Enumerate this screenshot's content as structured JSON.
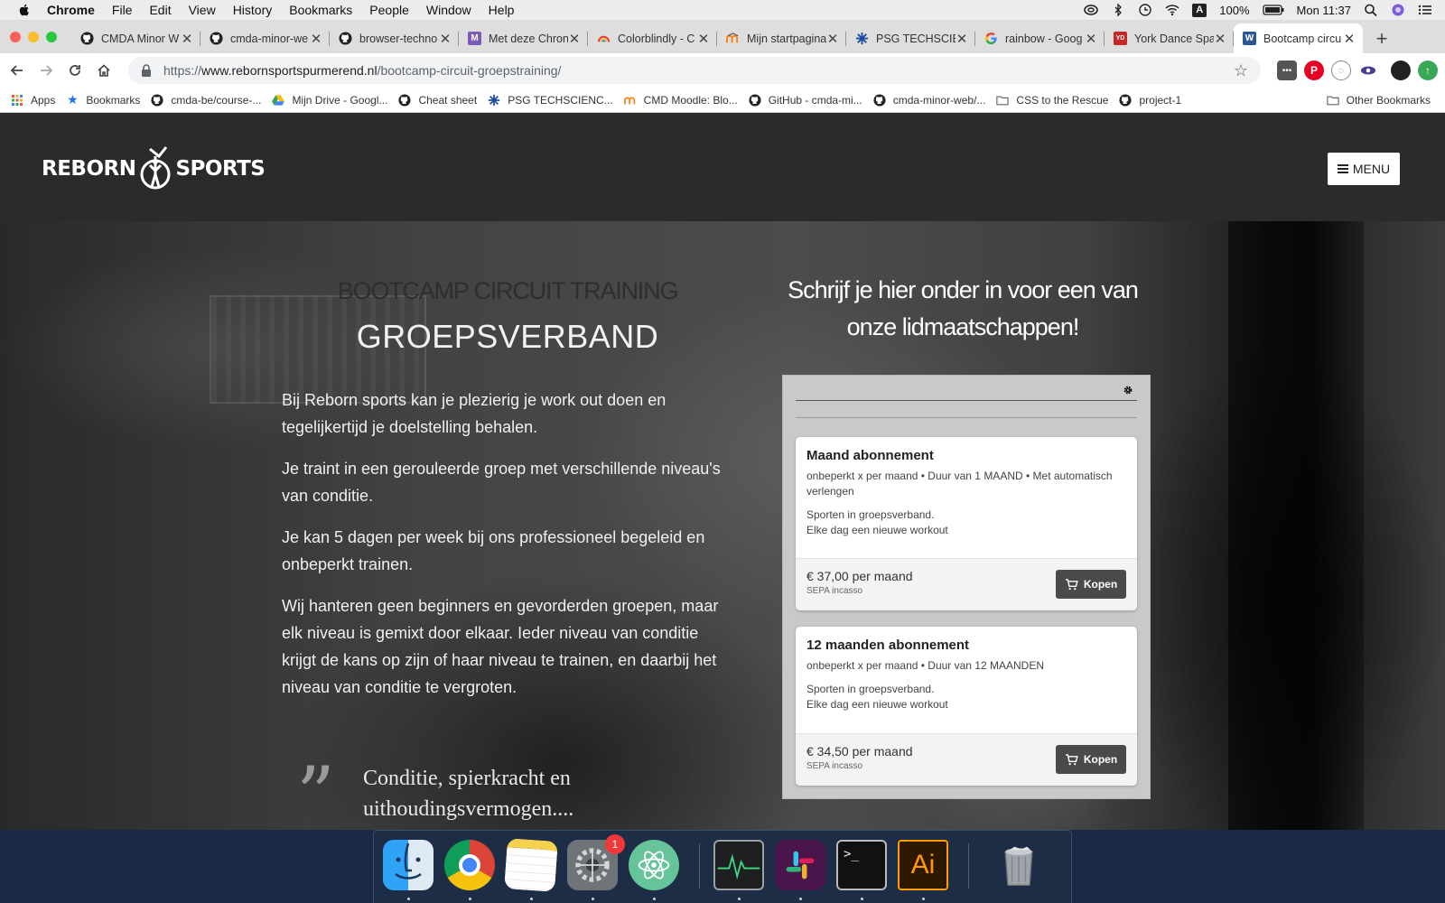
{
  "menubar": {
    "app": "Chrome",
    "items": [
      "File",
      "Edit",
      "View",
      "History",
      "Bookmarks",
      "People",
      "Window",
      "Help"
    ],
    "battery": "100%",
    "clock": "Mon 11:37",
    "input_indicator": "A"
  },
  "tabs": [
    {
      "title": "CMDA Minor W",
      "icon": "github-icon"
    },
    {
      "title": "cmda-minor-we",
      "icon": "github-icon"
    },
    {
      "title": "browser-techno",
      "icon": "github-icon"
    },
    {
      "title": "Met deze Chron",
      "icon": "medium-icon"
    },
    {
      "title": "Colorblindly - C",
      "icon": "rainbow-icon"
    },
    {
      "title": "Mijn startpagina",
      "icon": "moodle-icon"
    },
    {
      "title": "PSG TECHSCIE",
      "icon": "psg-icon"
    },
    {
      "title": "rainbow - Goog",
      "icon": "google-icon"
    },
    {
      "title": "York Dance Spa",
      "icon": "ydsa-icon"
    },
    {
      "title": "Bootcamp circu",
      "icon": "wordpress-icon",
      "active": true
    }
  ],
  "address": {
    "scheme": "https://",
    "host": "www.rebornsportspurmerend.nl",
    "path": "/bootcamp-circuit-groepstraining/"
  },
  "bookmarks": [
    {
      "label": "Apps",
      "icon": "apps-grid-icon"
    },
    {
      "label": "Bookmarks",
      "icon": "star-icon"
    },
    {
      "label": "cmda-be/course-...",
      "icon": "github-icon"
    },
    {
      "label": "Mijn Drive - Googl...",
      "icon": "google-drive-icon"
    },
    {
      "label": "Cheat sheet",
      "icon": "github-icon"
    },
    {
      "label": "PSG TECHSCIENC...",
      "icon": "psg-icon"
    },
    {
      "label": "CMD Moodle: Blo...",
      "icon": "moodle-icon"
    },
    {
      "label": "GitHub - cmda-mi...",
      "icon": "github-icon"
    },
    {
      "label": "cmda-minor-web/...",
      "icon": "github-icon"
    },
    {
      "label": "CSS to the Rescue",
      "icon": "folder-icon"
    },
    {
      "label": "project-1",
      "icon": "github-icon"
    }
  ],
  "other_bookmarks": "Other Bookmarks",
  "site": {
    "logo_left": "REBORN",
    "logo_right": "SPORTS",
    "menu_label": "MENU",
    "heading_small": "BOOTCAMP CIRCUIT TRAINING",
    "heading_big": "GROEPSVERBAND",
    "paragraphs": [
      "Bij Reborn sports kan je plezierig je work out doen en tegelijkertijd je doelstelling behalen.",
      "Je traint in een gerouleerde groep met verschillende niveau's van conditie.",
      "Je kan 5 dagen per week bij ons professioneel begeleid en onbeperkt trainen.",
      "Wij hanteren geen beginners en gevorderden groepen, maar elk niveau is gemixt door elkaar. Ieder niveau van conditie krijgt de kans op zijn of haar niveau te trainen, en daarbij het niveau van conditie te vergroten."
    ],
    "quote": "Conditie, spierkracht en uithoudingsvermogen....",
    "cta": "Schrijf je hier onder in voor een van onze lidmaatschappen!",
    "plans": [
      {
        "title": "Maand abonnement",
        "meta": "onbeperkt x per maand • Duur van 1 MAAND • Met automatisch verlengen",
        "desc1": "Sporten in groepsverband.",
        "desc2": "Elke dag een nieuwe workout",
        "price": "€ 37,00 per maand",
        "method": "SEPA incasso",
        "buy": "Kopen"
      },
      {
        "title": "12 maanden abonnement",
        "meta": "onbeperkt x per maand • Duur van 12 MAANDEN",
        "desc1": "Sporten in groepsverband.",
        "desc2": "Elke dag een nieuwe workout",
        "price": "€ 34,50 per maand",
        "method": "SEPA incasso",
        "buy": "Kopen"
      }
    ]
  },
  "dock": {
    "apps": [
      "finder-icon",
      "chrome-icon",
      "notes-icon",
      "system-preferences-icon",
      "atom-icon",
      "activity-monitor-icon",
      "slack-icon",
      "terminal-icon",
      "illustrator-icon",
      "trash-icon"
    ],
    "badge": "1",
    "terminal_prompt": ">_",
    "illustrator_label": "Ai"
  },
  "colors": {
    "accent_tab": "#ffffff",
    "site_header": "#2b2b2b",
    "buy_button": "#4a4a4a",
    "dock_background": "#1b2a44"
  }
}
